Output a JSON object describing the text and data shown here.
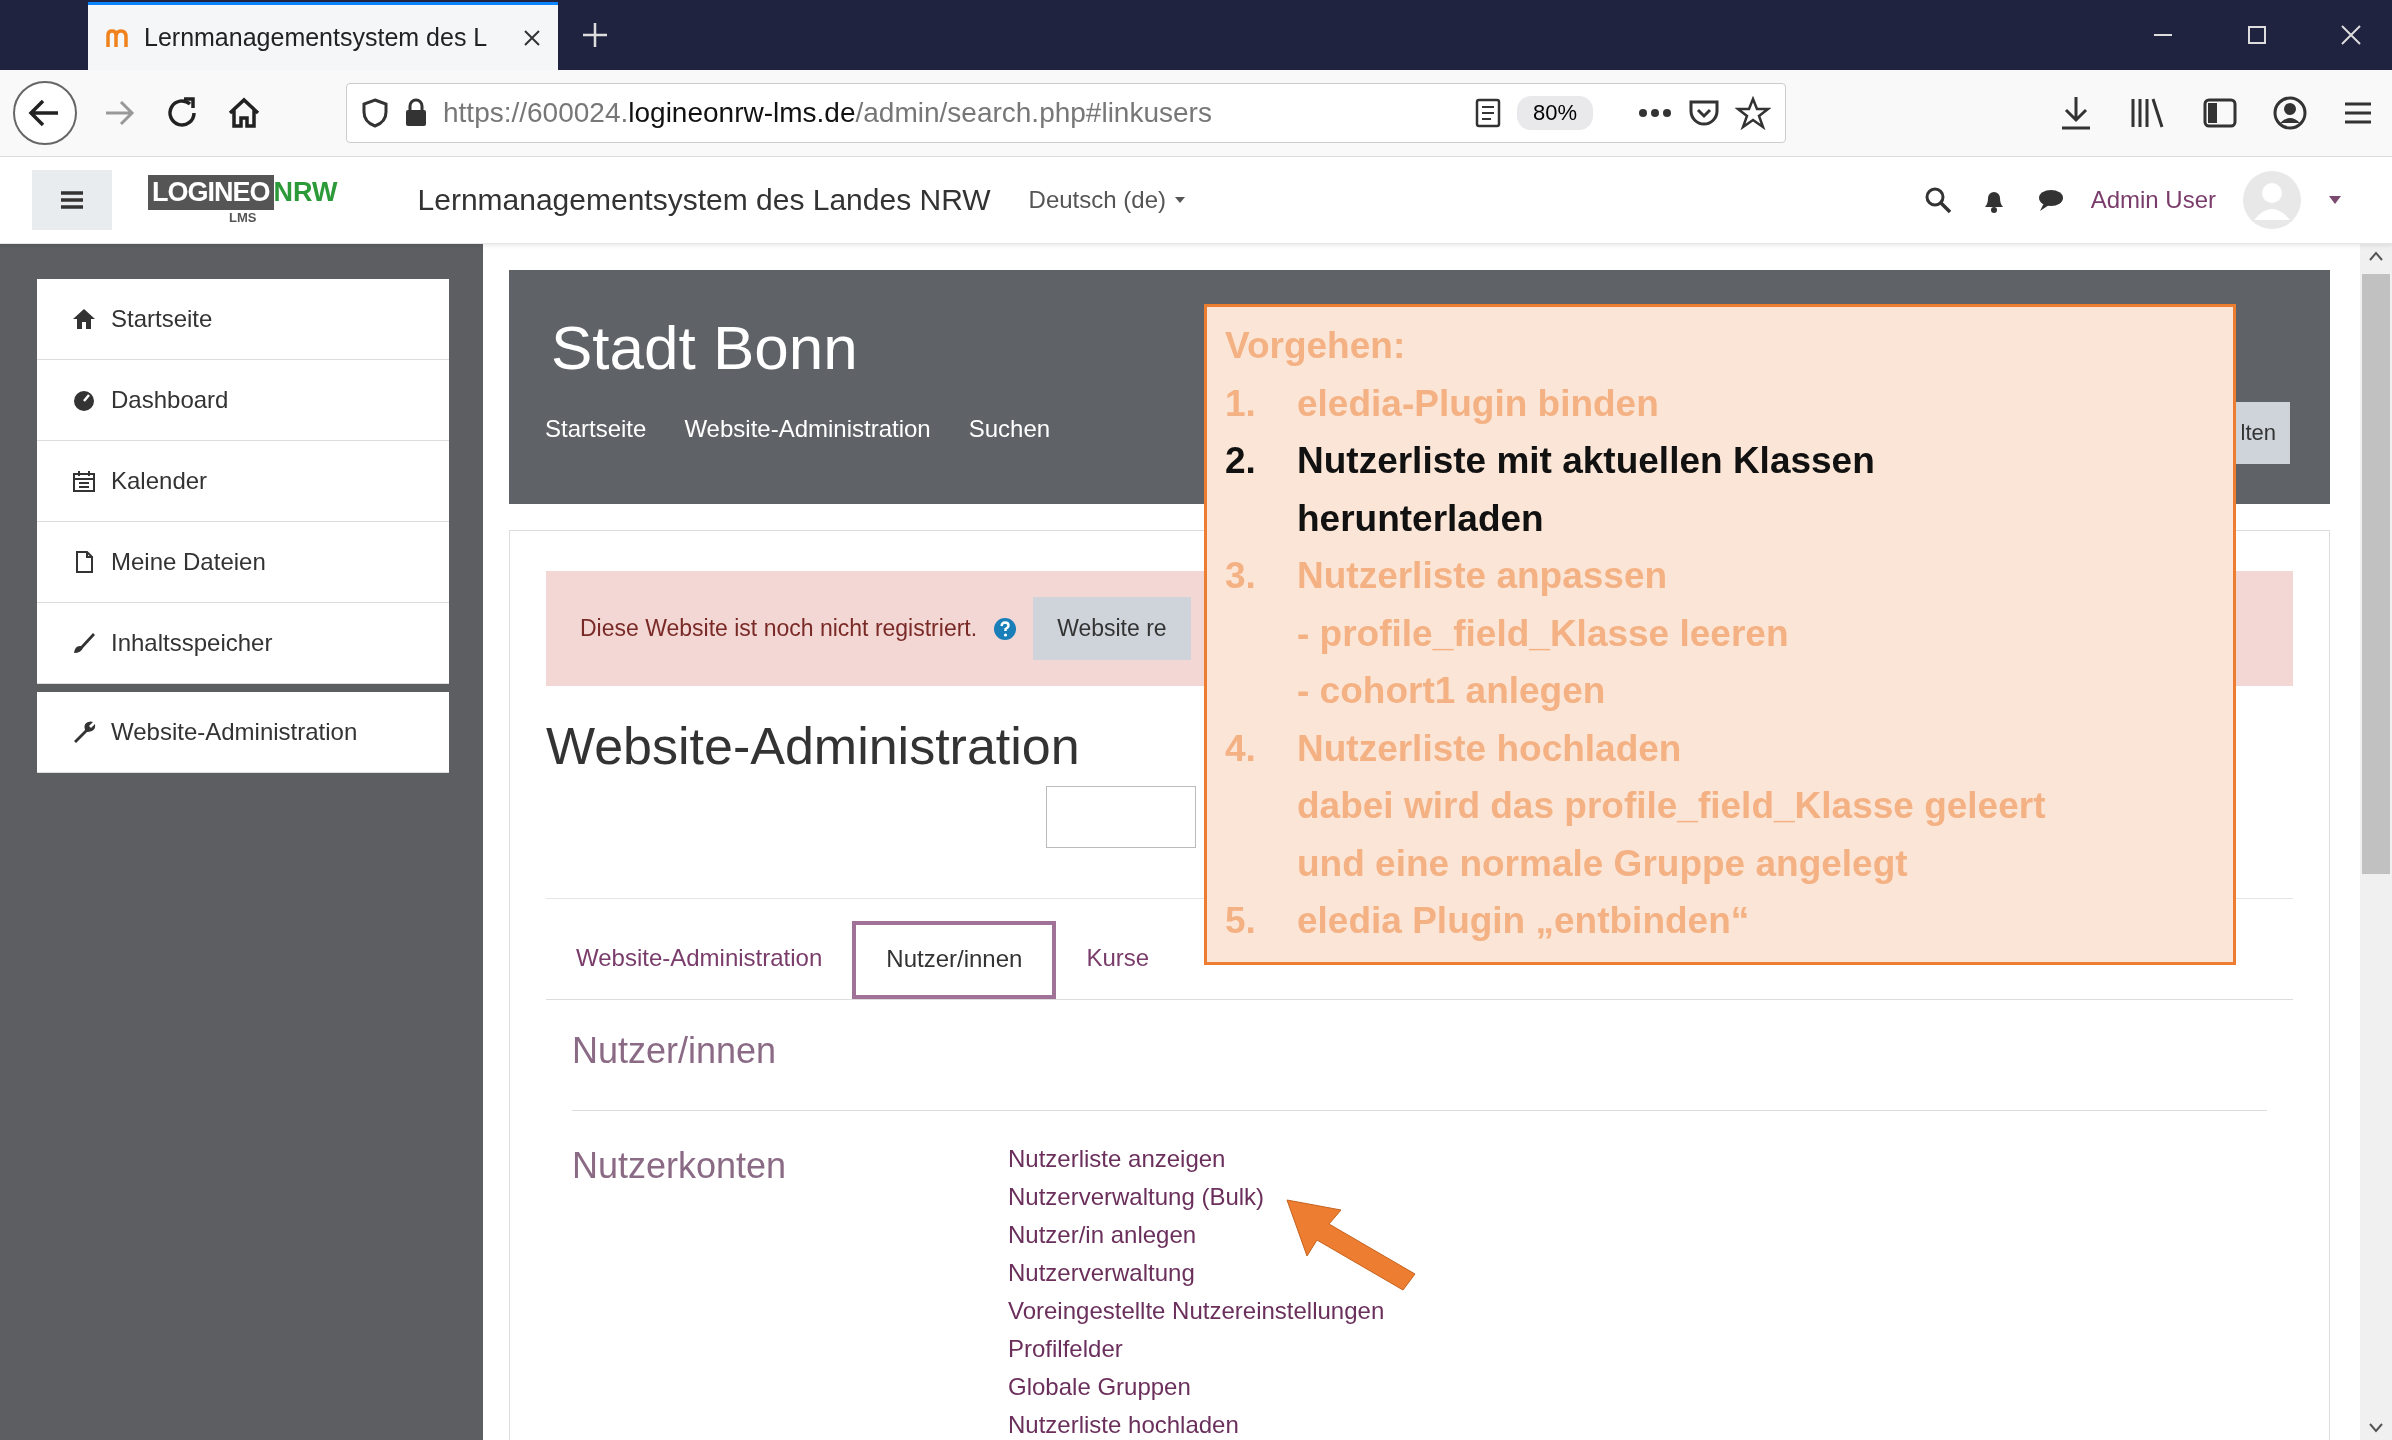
{
  "browser": {
    "tab_title": "Lernmanagementsystem des L",
    "url_host_prefix": "https://600024.",
    "url_domain": "logineonrw-lms.de",
    "url_path": "/admin/search.php#linkusers",
    "zoom": "80%"
  },
  "header": {
    "logo_main": "LOGINEO",
    "logo_accent": "NRW",
    "logo_sub": "LMS",
    "site_name": "Lernmanagementsystem des Landes NRW",
    "language": "Deutsch (de)",
    "user": "Admin User"
  },
  "sidebar": {
    "items": [
      {
        "label": "Startseite"
      },
      {
        "label": "Dashboard"
      },
      {
        "label": "Kalender"
      },
      {
        "label": "Meine Dateien"
      },
      {
        "label": "Inhaltsspeicher"
      }
    ],
    "admin_items": [
      {
        "label": "Website-Administration"
      }
    ]
  },
  "page_header": {
    "title": "Stadt Bonn",
    "breadcrumb": [
      "Startseite",
      "Website-Administration",
      "Suchen"
    ],
    "button": "lten"
  },
  "alert": {
    "text": "Diese Website ist noch nicht registriert.",
    "button": "Website re"
  },
  "heading": "Website-Administration",
  "tabs": [
    {
      "label": "Website-Administration",
      "selected": false
    },
    {
      "label": "Nutzer/innen",
      "selected": true
    },
    {
      "label": "Kurse",
      "selected": false
    }
  ],
  "section_title": "Nutzer/innen",
  "category": "Nutzerkonten",
  "links": [
    "Nutzerliste anzeigen",
    "Nutzerverwaltung (Bulk)",
    "Nutzer/in anlegen",
    "Nutzerverwaltung",
    "Voreingestellte Nutzereinstellungen",
    "Profilfelder",
    "Globale Gruppen",
    "Nutzerliste hochladen"
  ],
  "callout": {
    "title": "Vorgehen:",
    "steps": [
      {
        "number": "1.",
        "lines": [
          "eledia-Plugin binden"
        ],
        "highlighted": false
      },
      {
        "number": "2.",
        "lines": [
          "Nutzerliste mit aktuellen Klassen",
          "herunterladen"
        ],
        "highlighted": true
      },
      {
        "number": "3.",
        "lines": [
          "Nutzerliste anpassen",
          "- profile_field_Klasse leeren",
          "- cohort1 anlegen"
        ],
        "highlighted": false
      },
      {
        "number": "4.",
        "lines": [
          "Nutzerliste hochladen",
          "dabei wird das profile_field_Klasse geleert",
          "und eine normale Gruppe angelegt"
        ],
        "highlighted": false
      },
      {
        "number": "5.",
        "lines": [
          "eledia Plugin „entbinden“"
        ],
        "highlighted": false
      }
    ]
  }
}
